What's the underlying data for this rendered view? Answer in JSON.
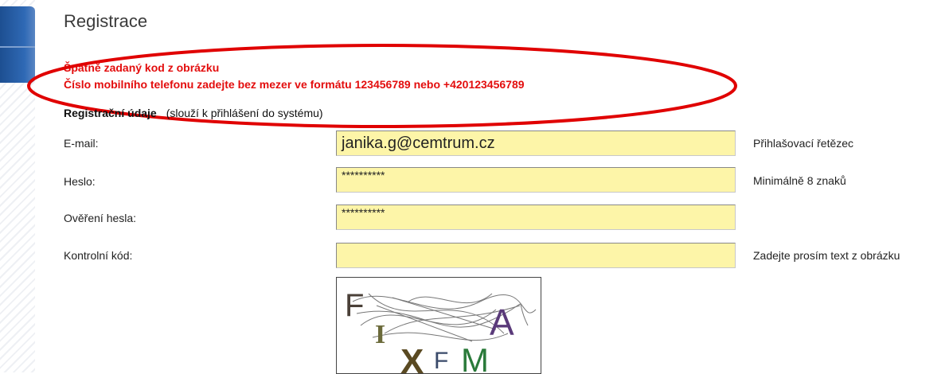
{
  "page": {
    "title": "Registrace"
  },
  "errors": [
    "Špatně zadaný kod z obrázku",
    "Číslo mobilního telefonu zadejte bez mezer ve formátu 123456789 nebo +420123456789"
  ],
  "section": {
    "heading": "Registrační údaje",
    "note": "(slouží k přihlášení do systému)"
  },
  "fields": {
    "email": {
      "label": "E-mail:",
      "value": "janika.g@cemtrum.cz",
      "hint": "Přihlašovací řetězec"
    },
    "password": {
      "label": "Heslo:",
      "value": "**********",
      "hint": "Minimálně 8 znaků"
    },
    "password_confirm": {
      "label": "Ověření hesla:",
      "value": "**********"
    },
    "captcha": {
      "label": "Kontrolní kód:",
      "value": "",
      "hint": "Zadejte prosím text z obrázku"
    }
  },
  "captcha_image": {
    "text": "FIXFMA"
  },
  "colors": {
    "error": "#e30d0d",
    "field_bg": "#fdf5a8",
    "annotation_ellipse": "#e00000",
    "accent_blue": "#2f69b5"
  }
}
